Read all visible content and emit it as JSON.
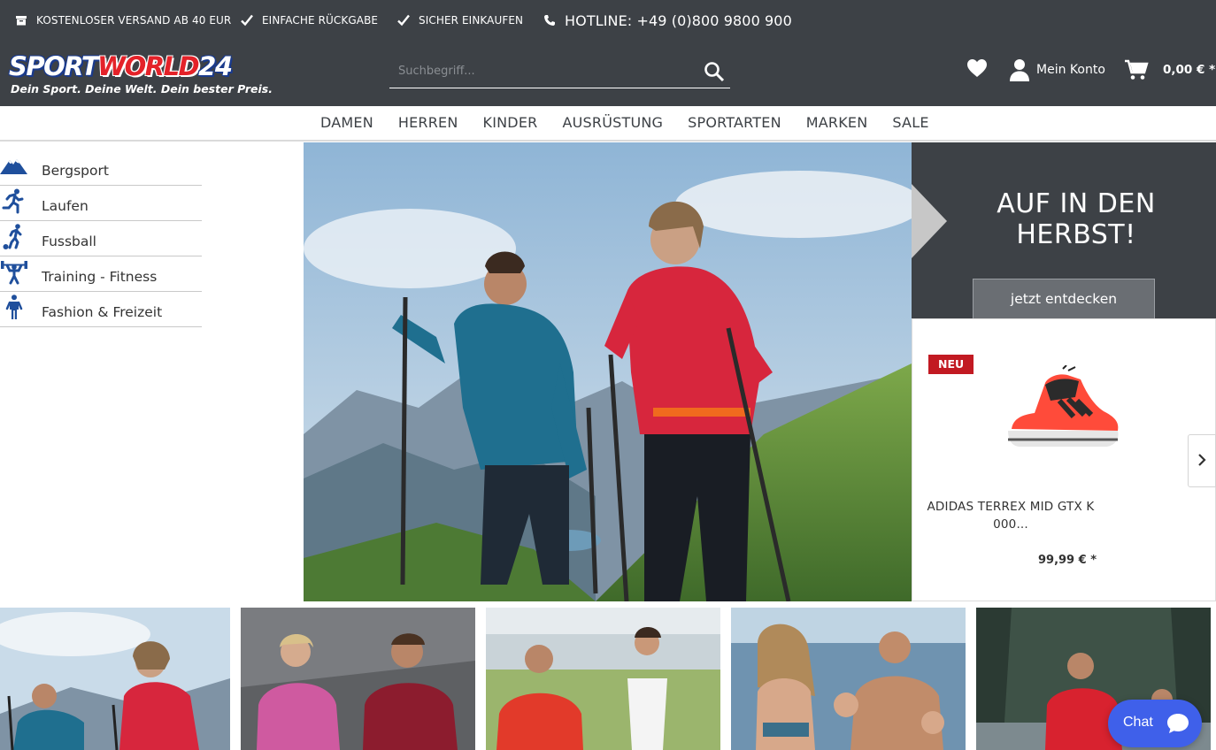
{
  "usp_bar": {
    "items": [
      {
        "icon": "box-icon",
        "text": "KOSTENLOSER VERSAND AB 40 EUR"
      },
      {
        "icon": "check-icon",
        "text": "EINFACHE RÜCKGABE"
      },
      {
        "icon": "check-icon",
        "text": "SICHER EINKAUFEN"
      },
      {
        "icon": "phone-icon",
        "text": "HOTLINE: +49 (0)800 9800 900"
      }
    ]
  },
  "logo": {
    "part1": "SPORT",
    "part2": "WORLD",
    "part3": "24",
    "slogan": "Dein Sport. Deine Welt. Dein bester Preis."
  },
  "search": {
    "placeholder": "Suchbegriff..."
  },
  "header_actions": {
    "wishlist_icon": "heart-icon",
    "account_label": "Mein Konto",
    "cart_total": "0,00 € *"
  },
  "nav": {
    "items": [
      "DAMEN",
      "HERREN",
      "KINDER",
      "AUSRÜSTUNG",
      "SPORTARTEN",
      "MARKEN",
      "SALE"
    ]
  },
  "sidebar": {
    "categories": [
      {
        "label": "Bergsport",
        "icon": "mountain-icon"
      },
      {
        "label": "Laufen",
        "icon": "runner-icon"
      },
      {
        "label": "Fussball",
        "icon": "football-player-icon"
      },
      {
        "label": "Training - Fitness",
        "icon": "weightlifter-icon"
      },
      {
        "label": "Fashion & Freizeit",
        "icon": "person-icon"
      }
    ]
  },
  "promo": {
    "title": "AUF IN DEN HERBST!",
    "button": "jetzt entdecken"
  },
  "product": {
    "badge": "NEU",
    "name": "ADIDAS TERREX MID GTX K 000...",
    "price": "99,99 € *"
  },
  "chat": {
    "label": "Chat"
  },
  "colors": {
    "header_bg": "#3d4146",
    "brand_red": "#e42229",
    "brand_blue": "#1a3a8c",
    "badge_red": "#c21a22",
    "chat_blue": "#3f60ea"
  }
}
